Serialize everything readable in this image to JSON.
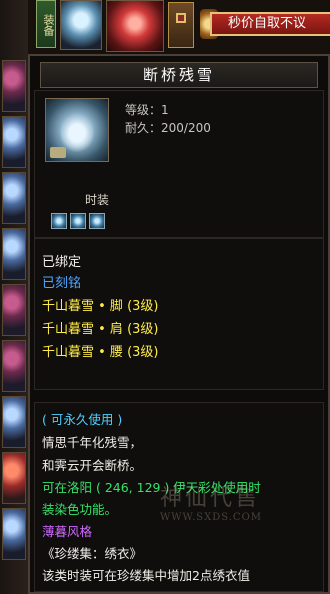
{
  "top": {
    "equip_tab": "装备",
    "banner_text": "秒价自取不议"
  },
  "tooltip": {
    "title": "断桥残雪",
    "level": "等级：1",
    "durability": "耐久：200/200",
    "type": "时装",
    "gem_slots": 3,
    "bound": "已绑定",
    "engraved": "已刻铭",
    "set_parts": [
      "千山暮雪 • 脚 (3级)",
      "千山暮雪 • 肩 (3级)",
      "千山暮雪 • 腰 (3级)"
    ],
    "desc": {
      "permanent": "( 可永久使用 )",
      "poem_1": "情思千年化残雪，",
      "poem_2": "和霁云开会断桥。",
      "dye_1": "可在洛阳 ( 246, 129 ) 伊天彩处使用时",
      "dye_2": "装染色功能。",
      "style": "薄暮风格",
      "collection": "《珍缕集：绣衣》",
      "collection_desc": "该类时装可在珍缕集中增加2点绣衣值"
    }
  },
  "watermark": {
    "text": "神仙代售",
    "url": "WWW.SXDS.COM"
  },
  "colors": {
    "set_yellow": "#ffeb4a",
    "engraved_blue": "#4ea5ff",
    "permanent_cyan": "#4fd0ff",
    "dye_green": "#36e36a",
    "style_purple": "#d067ff"
  }
}
